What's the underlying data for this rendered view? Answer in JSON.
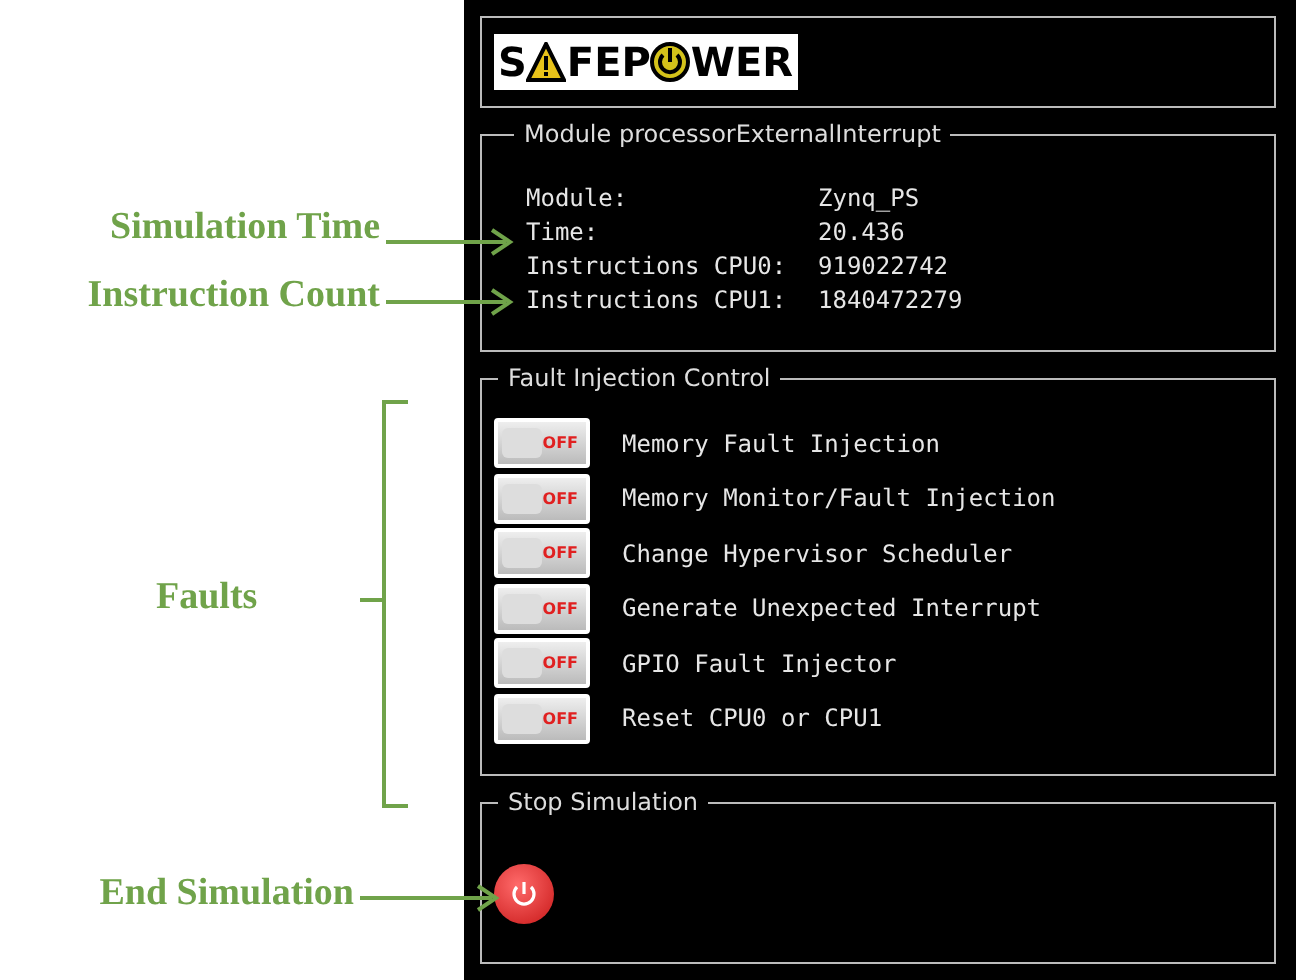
{
  "annotations": [
    {
      "text": "Simulation Time",
      "kind": "arrow"
    },
    {
      "text": "Instruction Count",
      "kind": "arrow"
    },
    {
      "text": "Faults",
      "kind": "brace"
    },
    {
      "text": "End Simulation",
      "kind": "arrow"
    }
  ],
  "logo": {
    "before": "S",
    "middle": "FEP",
    "after": "WER"
  },
  "module_panel": {
    "title": "Module processorExternalInterrupt",
    "rows": [
      {
        "label": "Module:",
        "value": "Zynq_PS"
      },
      {
        "label": "Time:",
        "value": "20.436"
      },
      {
        "label": "Instructions CPU0:",
        "value": "919022742"
      },
      {
        "label": "Instructions CPU1:",
        "value": "1840472279"
      }
    ]
  },
  "fault_panel": {
    "title": "Fault Injection Control",
    "items": [
      {
        "label": "Memory Fault Injection",
        "on": false,
        "switch_text": "OFF"
      },
      {
        "label": "Memory Monitor/Fault Injection",
        "on": false,
        "switch_text": "OFF"
      },
      {
        "label": "Change Hypervisor Scheduler",
        "on": false,
        "switch_text": "OFF"
      },
      {
        "label": "Generate Unexpected Interrupt",
        "on": false,
        "switch_text": "OFF"
      },
      {
        "label": "GPIO Fault Injector",
        "on": false,
        "switch_text": "OFF"
      },
      {
        "label": "Reset CPU0 or CPU1",
        "on": false,
        "switch_text": "OFF"
      }
    ]
  },
  "stop_panel": {
    "title": "Stop Simulation"
  }
}
